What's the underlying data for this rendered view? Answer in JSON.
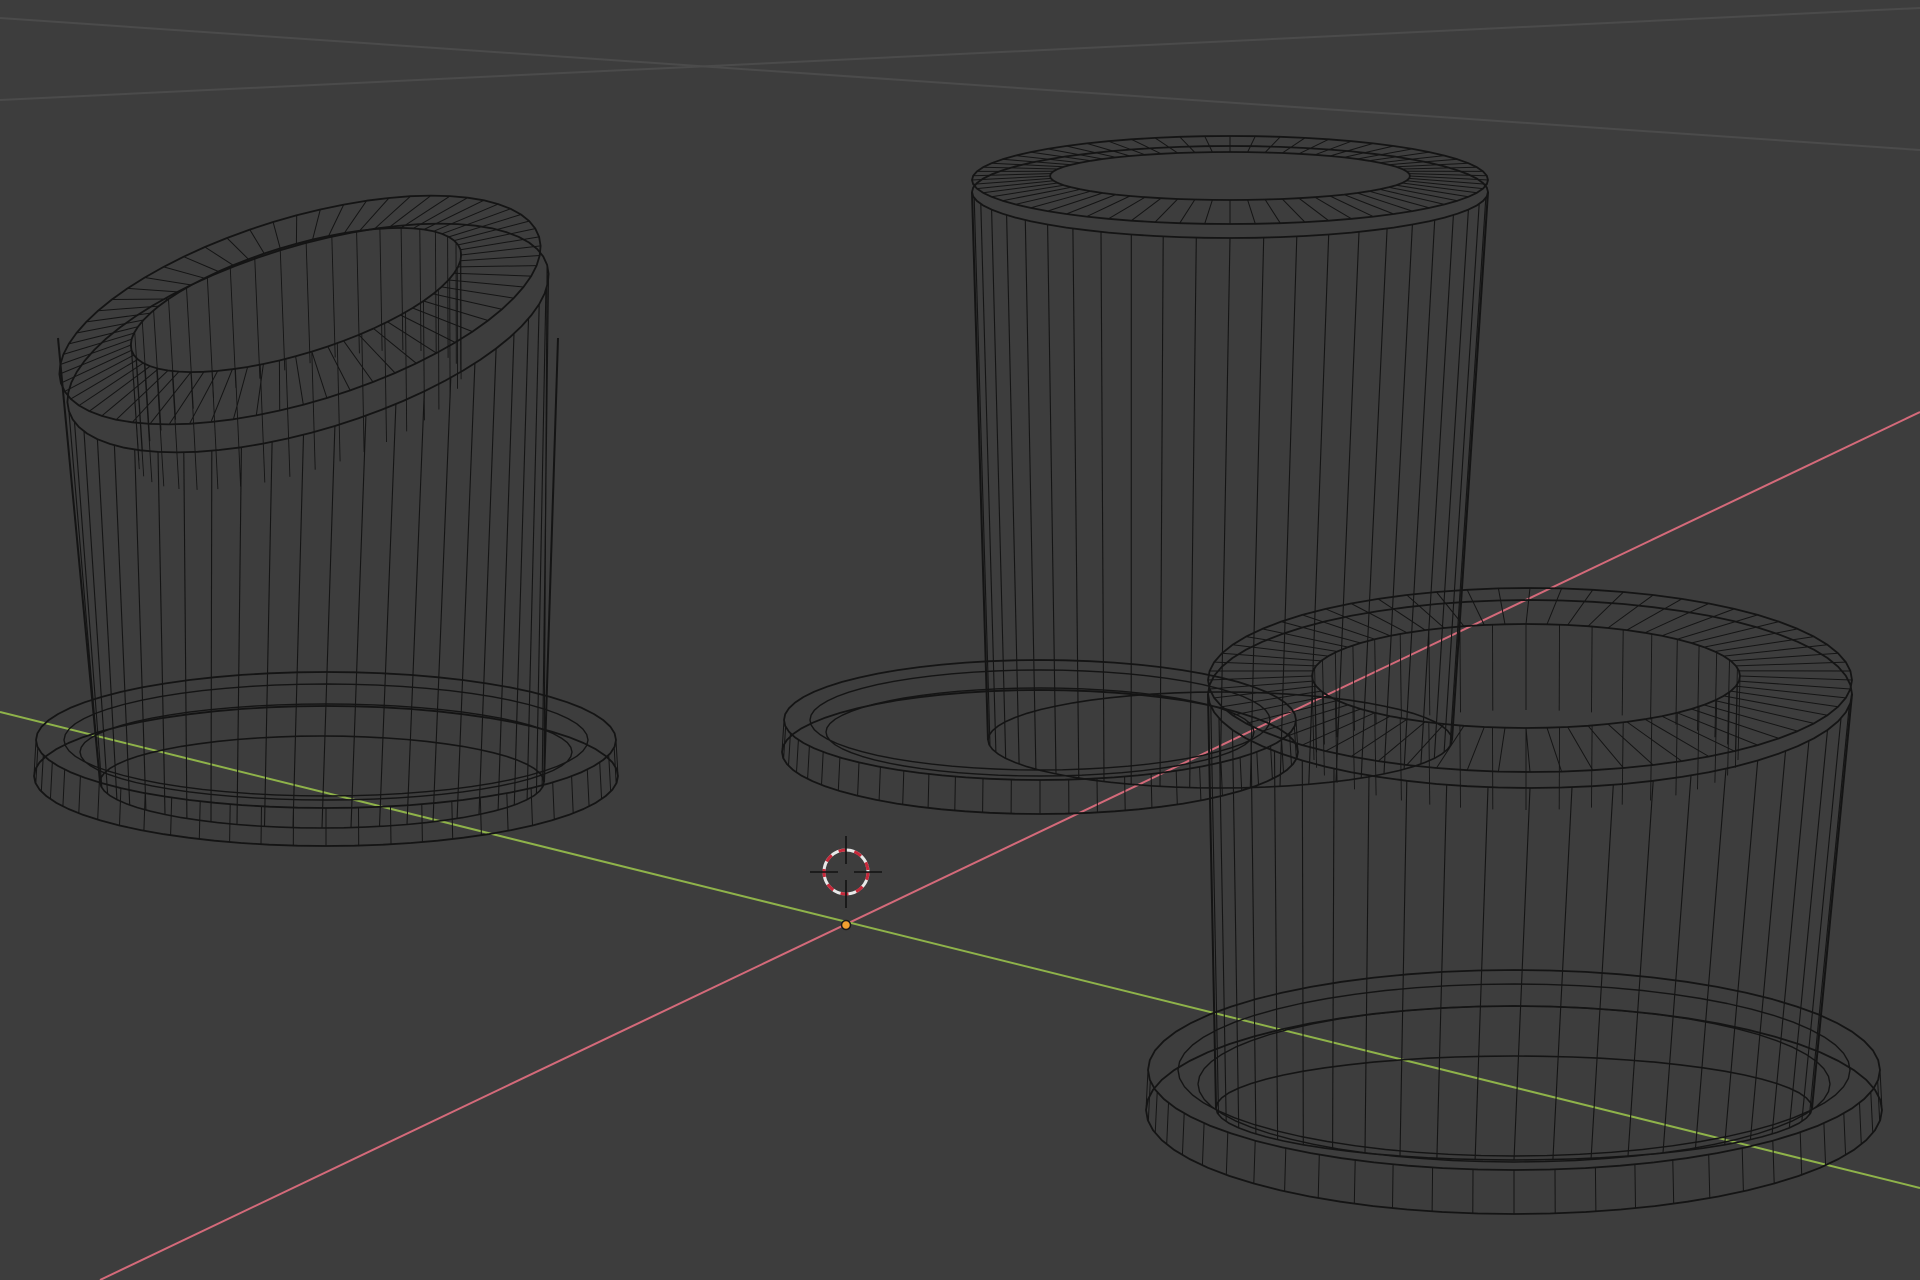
{
  "viewport": {
    "view": "3d-viewport",
    "shading": "wireframe",
    "background_color": "#3d3d3d",
    "grid_color": "#4b4b4b",
    "wire_color": "#141414",
    "axis_x_color": "#d46a7a",
    "axis_y_color": "#8fb34a",
    "cursor_ring_colors": [
      "#e8e8e8",
      "#c8283a"
    ],
    "origin_dot_color": "#f0a030",
    "objects": [
      {
        "name": "slanted-pot",
        "icon": "cylinder-mesh-icon"
      },
      {
        "name": "tall-pot",
        "icon": "cylinder-mesh-icon"
      },
      {
        "name": "short-pot",
        "icon": "cylinder-mesh-icon"
      }
    ]
  }
}
